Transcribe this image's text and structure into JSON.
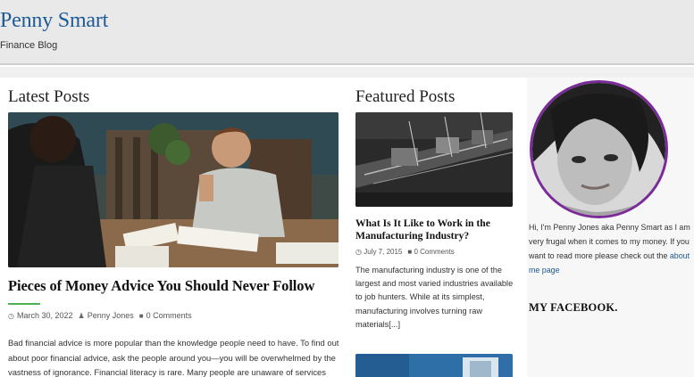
{
  "header": {
    "site_title": "Penny Smart",
    "tagline": "Finance Blog"
  },
  "latest": {
    "heading": "Latest Posts",
    "post": {
      "title": "Pieces of Money Advice You Should Never Follow",
      "date": "March 30, 2022",
      "author": "Penny Jones",
      "comments": "0 Comments",
      "excerpt": "Bad financial advice is more popular than the knowledge people need to have. To find out about poor financial advice, ask the people around you—you will be overwhelmed by the vastness of ignorance. Financial literacy is rare. Many people are unaware of services such"
    }
  },
  "featured": {
    "heading": "Featured Posts",
    "post": {
      "title": "What Is It Like to Work in the Manufacturing Industry?",
      "date": "July 7, 2015",
      "comments": "0 Comments",
      "excerpt": "The manufacturing industry is one of the largest and most varied industries available to job hunters. While at its simplest, manufacturing involves turning raw materials[...]"
    }
  },
  "sidebar": {
    "bio_text": "Hi, I'm Penny Jones aka Penny Smart as I am very frugal when it comes to my money. If you want to read more please check out the ",
    "bio_link": "about me page",
    "facebook_heading": "MY FACEBOOK."
  },
  "colors": {
    "link": "#1e5a96",
    "accent_underline": "#4caf50",
    "avatar_border": "#7b2a9a"
  },
  "icons": {
    "date": "clock-icon",
    "author": "user-icon",
    "comments": "comment-icon"
  }
}
